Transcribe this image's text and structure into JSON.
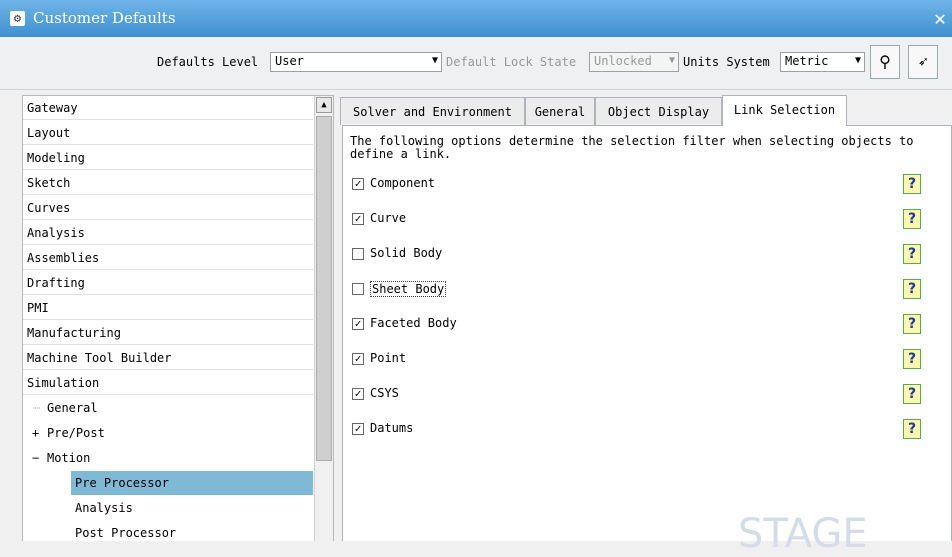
{
  "window": {
    "title": "Customer Defaults",
    "close_glyph": "✕"
  },
  "toolbar": {
    "defaults_level_label": "Defaults Level",
    "defaults_level_value": "User",
    "lock_state_label": "Default Lock State",
    "lock_state_value": "Unlocked",
    "units_label": "Units System",
    "units_value": "Metric",
    "icons": [
      "binoculars-icon",
      "key-pointer-icon"
    ]
  },
  "tree": {
    "items": [
      "Gateway",
      "Layout",
      "Modeling",
      "Sketch",
      "Curves",
      "Analysis",
      "Assemblies",
      "Drafting",
      "PMI",
      "Manufacturing",
      "Machine Tool Builder",
      "Simulation"
    ],
    "sub_items": [
      "General",
      "Pre/Post",
      "Motion",
      "Pre Processor",
      "Analysis",
      "Post Processor"
    ],
    "expander_plus": "+",
    "expander_minus": "−"
  },
  "tabs": [
    "Solver and Environment",
    "General",
    "Object Display",
    "Link Selection"
  ],
  "active_tab": "Link Selection",
  "description": "The following options determine the selection filter when selecting objects to define a link.",
  "options": [
    {
      "label": "Component",
      "checked": true
    },
    {
      "label": "Curve",
      "checked": true
    },
    {
      "label": "Solid Body",
      "checked": false
    },
    {
      "label": "Sheet Body",
      "checked": false
    },
    {
      "label": "Faceted Body",
      "checked": true
    },
    {
      "label": "Point",
      "checked": true
    },
    {
      "label": "CSYS",
      "checked": true
    },
    {
      "label": "Datums",
      "checked": true
    }
  ],
  "help_glyph": "?",
  "check_glyph": "✓",
  "watermark": "STAGE",
  "colors": {
    "title_bar": "#4a9ad8",
    "selected_item": "#7fb9d6"
  }
}
